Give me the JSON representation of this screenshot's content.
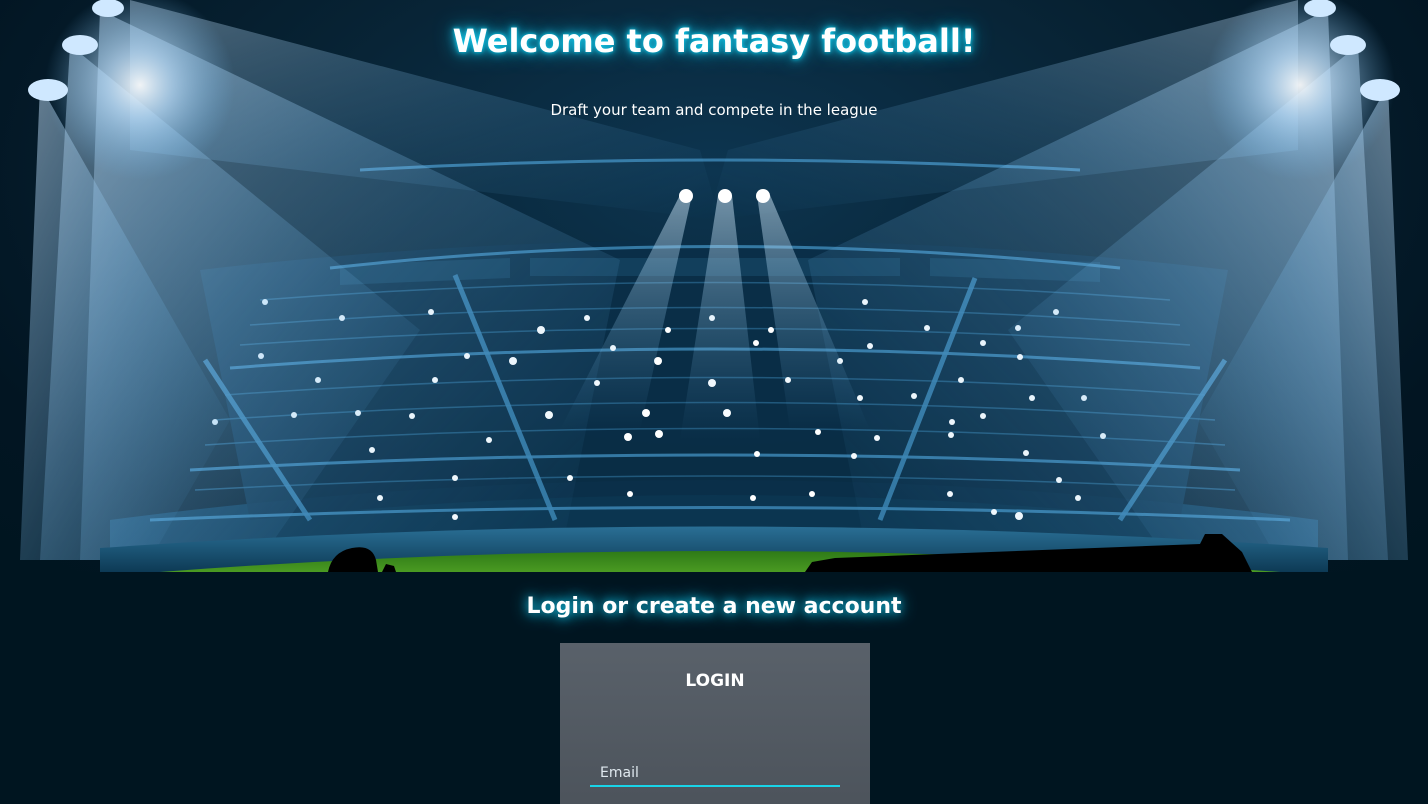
{
  "hero": {
    "title": "Welcome to fantasy football!",
    "subtitle": "Draft your team and compete in the league"
  },
  "auth": {
    "heading": "Login or create a new account",
    "login": {
      "title": "LOGIN",
      "email_placeholder": "Email",
      "email_value": ""
    }
  },
  "colors": {
    "background": "#001520",
    "glow": "#19c3e6",
    "card": "#4f565e",
    "field_underline": "#19d4e8",
    "pitch": "#3f8a1e"
  }
}
